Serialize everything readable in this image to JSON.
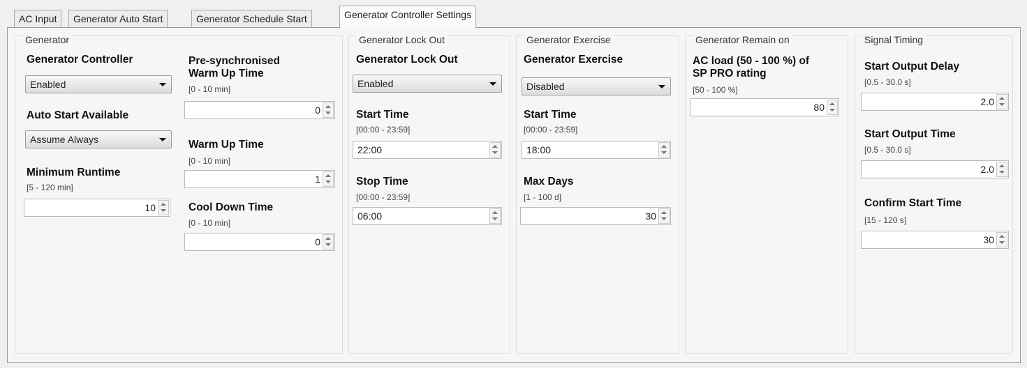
{
  "tabs": [
    {
      "label": "AC Input"
    },
    {
      "label": "Generator Auto Start"
    },
    {
      "label": "Generator Schedule Start"
    },
    {
      "label": "Generator Controller Settings"
    }
  ],
  "active_tab": "Generator Controller Settings",
  "generator": {
    "title": "Generator",
    "controller_label": "Generator Controller",
    "controller_value": "Enabled",
    "auto_start_label": "Auto Start Available",
    "auto_start_value": "Assume Always",
    "min_runtime_label": "Minimum Runtime",
    "min_runtime_range": "[5 - 120 min]",
    "min_runtime_value": "10",
    "presync_label_line1": "Pre-synchronised",
    "presync_label_line2": "Warm Up Time",
    "presync_range": "[0 - 10 min]",
    "presync_value": "0",
    "warmup_label": "Warm Up Time",
    "warmup_range": "[0 - 10 min]",
    "warmup_value": "1",
    "cooldown_label": "Cool Down Time",
    "cooldown_range": "[0 - 10 min]",
    "cooldown_value": "0"
  },
  "lockout": {
    "title": "Generator Lock Out",
    "label": "Generator Lock Out",
    "value": "Enabled",
    "start_label": "Start Time",
    "start_range": "[00:00 - 23:59]",
    "start_value": "22:00",
    "stop_label": "Stop Time",
    "stop_range": "[00:00 - 23:59]",
    "stop_value": "06:00"
  },
  "exercise": {
    "title": "Generator Exercise",
    "label": "Generator Exercise",
    "value": "Disabled",
    "start_label": "Start Time",
    "start_range": "[00:00 - 23:59]",
    "start_value": "18:00",
    "maxdays_label": "Max Days",
    "maxdays_range": "[1 - 100 d]",
    "maxdays_value": "30"
  },
  "remain": {
    "title": "Generator Remain on",
    "label_line1": "AC load (50 - 100 %) of",
    "label_line2": "SP PRO rating",
    "range": "[50 - 100 %]",
    "value": "80"
  },
  "signal": {
    "title": "Signal Timing",
    "delay_label": "Start Output Delay",
    "delay_range": "[0.5 - 30.0 s]",
    "delay_value": "2.0",
    "outtime_label": "Start Output Time",
    "outtime_range": "[0.5 - 30.0 s]",
    "outtime_value": "2.0",
    "confirm_label": "Confirm Start Time",
    "confirm_range": "[15 - 120 s]",
    "confirm_value": "30"
  }
}
